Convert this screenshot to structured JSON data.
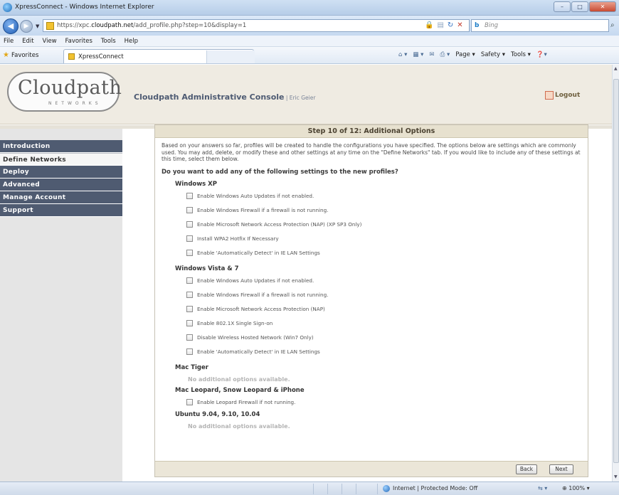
{
  "window": {
    "title": "XpressConnect - Windows Internet Explorer",
    "min_label": "–",
    "max_label": "□",
    "close_label": "✕"
  },
  "address": {
    "url_prefix": "https://xpc.",
    "url_host": "cloudpath.net",
    "url_path": "/add_profile.php?step=10&display=1",
    "search_placeholder": "Bing",
    "search_engine_label": "b"
  },
  "menu": [
    "File",
    "Edit",
    "View",
    "Favorites",
    "Tools",
    "Help"
  ],
  "favorites": {
    "label": "Favorites",
    "tab_title": "XpressConnect"
  },
  "commandbar": {
    "page": "Page ▾",
    "safety": "Safety ▾",
    "tools": "Tools ▾"
  },
  "header": {
    "logo_word": "Cloudpath",
    "logo_sub": "NETWORKS",
    "console_title": "Cloudpath Administrative Console",
    "separator": " | ",
    "user": "Eric Geier",
    "logout": "Logout"
  },
  "sidebar": {
    "items": [
      {
        "label": "Introduction",
        "active": false
      },
      {
        "label": "Define Networks",
        "active": true
      },
      {
        "label": "Deploy",
        "active": false
      },
      {
        "label": "Advanced",
        "active": false
      },
      {
        "label": "Manage Account",
        "active": false
      },
      {
        "label": "Support",
        "active": false
      }
    ]
  },
  "main": {
    "step_title": "Step 10 of 12: Additional Options",
    "intro": "Based on your answers so far, profiles will be created to handle the configurations you have specified. The options below are settings which are commonly used. You may add, delete, or modify these and other settings at any time on the \"Define Networks\" tab. If you would like to include any of these settings at this time, select them below.",
    "question": "Do you want to add any of the following settings to the new profiles?",
    "groups": [
      {
        "name": "Windows XP",
        "options": [
          "Enable Windows Auto Updates if not enabled.",
          "Enable Windows Firewall if a firewall is not running.",
          "Enable Microsoft Network Access Protection (NAP) (XP SP3 Only)",
          "Install WPA2 Hotfix If Necessary",
          "Enable 'Automatically Detect' in IE LAN Settings"
        ]
      },
      {
        "name": "Windows Vista & 7",
        "options": [
          "Enable Windows Auto Updates if not enabled.",
          "Enable Windows Firewall if a firewall is not running.",
          "Enable Microsoft Network Access Protection (NAP)",
          "Enable 802.1X Single Sign-on",
          "Disable Wireless Hosted Network (Win7 Only)",
          "Enable 'Automatically Detect' in IE LAN Settings"
        ]
      },
      {
        "name": "Mac Tiger",
        "none": "No additional options available."
      },
      {
        "name": "Mac Leopard, Snow Leopard & iPhone",
        "options": [
          "Enable Leopard Firewall if not running."
        ]
      },
      {
        "name": "Ubuntu 9.04, 9.10, 10.04",
        "none": "No additional options available."
      }
    ],
    "back_label": "Back",
    "next_label": "Next"
  },
  "status": {
    "zone": "Internet | Protected Mode: Off",
    "zoom": "100%"
  }
}
